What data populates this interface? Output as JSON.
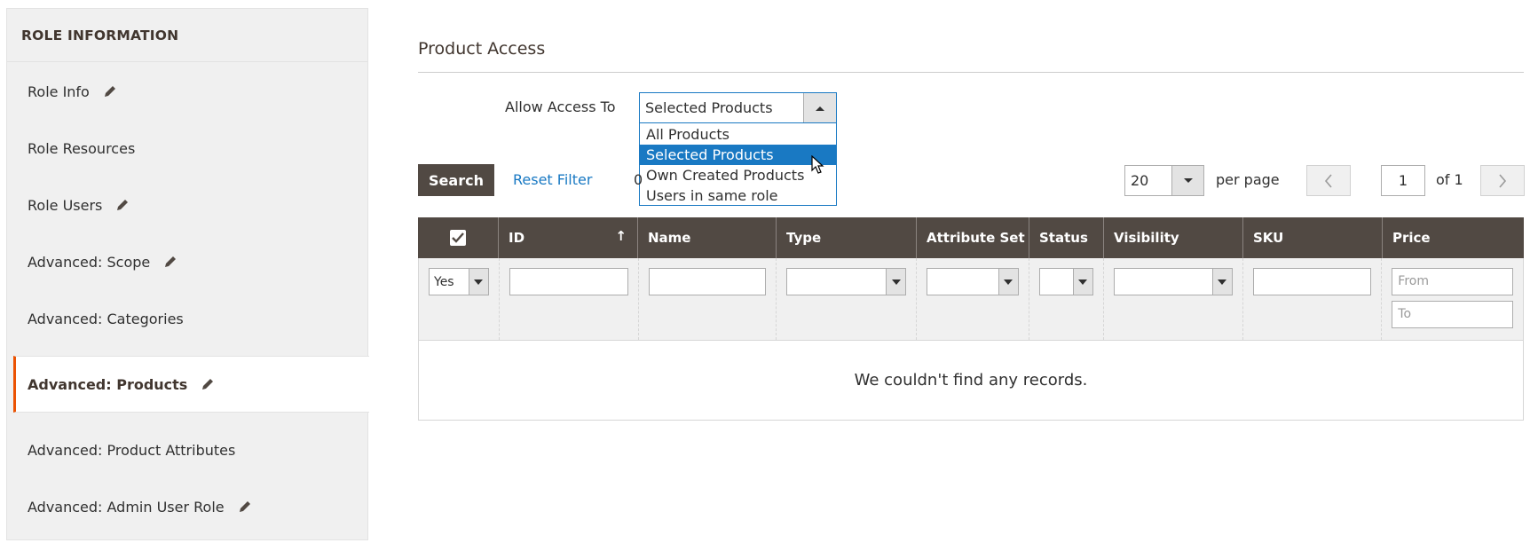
{
  "sidebar": {
    "title": "ROLE INFORMATION",
    "items": [
      {
        "label": "Role Info",
        "edited": true
      },
      {
        "label": "Role Resources",
        "edited": false
      },
      {
        "label": "Role Users",
        "edited": true
      },
      {
        "label": "Advanced: Scope",
        "edited": true
      },
      {
        "label": "Advanced: Categories",
        "edited": false
      },
      {
        "label": "Advanced: Products",
        "edited": true,
        "active": true
      },
      {
        "label": "Advanced: Product Attributes",
        "edited": false
      },
      {
        "label": "Advanced: Admin User Role",
        "edited": true
      }
    ]
  },
  "section": {
    "title": "Product Access",
    "allow_access_label": "Allow Access To",
    "allow_access_value": "Selected Products",
    "allow_access_options": [
      "All Products",
      "Selected Products",
      "Own Created Products",
      "Users in same role"
    ]
  },
  "toolbar": {
    "search_label": "Search",
    "reset_label": "Reset Filter",
    "records_count": "0",
    "per_page_value": "20",
    "per_page_label": "per page",
    "page_value": "1",
    "page_of": "of 1"
  },
  "grid": {
    "columns": [
      "",
      "ID",
      "Name",
      "Type",
      "Attribute Set",
      "Status",
      "Visibility",
      "SKU",
      "Price"
    ],
    "filter_in_products": "Yes",
    "price_from_placeholder": "From",
    "price_to_placeholder": "To",
    "empty_message": "We couldn't find any records."
  },
  "colors": {
    "header_bg": "#514943",
    "accent_active": "#eb5202",
    "link": "#1979c3"
  }
}
